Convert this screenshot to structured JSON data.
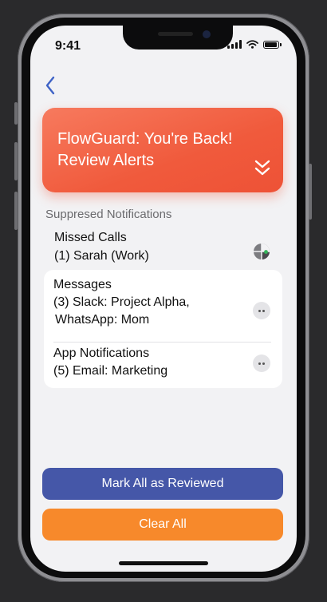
{
  "status_bar": {
    "time": "9:41"
  },
  "banner": {
    "title": "FlowGuard: You're Back! Review Alerts",
    "icon": "chevron-double-down-icon",
    "color": "#f05a3c"
  },
  "section": {
    "label": "Suppresed Notifications"
  },
  "missed_calls": {
    "title": "Missed Calls",
    "detail": "(1) Sarah (Work)",
    "icon": "pie-chart-icon"
  },
  "messages": {
    "title": "Messages",
    "detail_line1": "(3) Slack: Project Alpha,",
    "detail_line2": "WhatsApp: Mom",
    "icon": "more-icon"
  },
  "app_notifications": {
    "title": "App Notifications",
    "detail": "(5) Email: Marketing",
    "icon": "more-icon"
  },
  "actions": {
    "mark_all_label": "Mark All as Reviewed",
    "mark_all_color": "#4557a8",
    "clear_all_label": "Clear All",
    "clear_all_color": "#f7892b"
  }
}
